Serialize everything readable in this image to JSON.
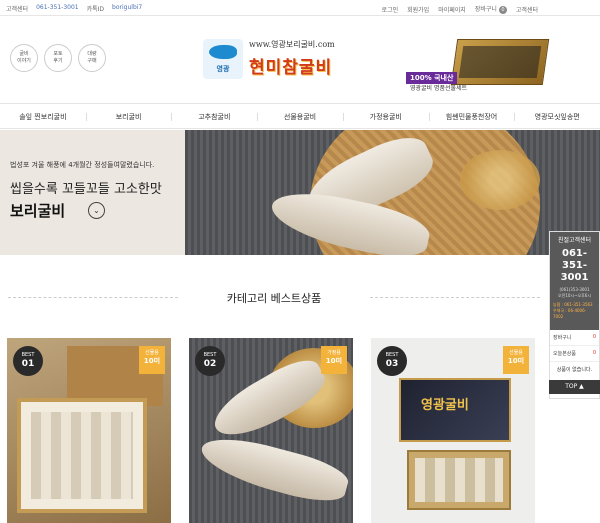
{
  "topbar": {
    "cs_label": "고객센터",
    "cs_phone": "061-351-3001",
    "kakao_label": "카톡ID",
    "kakao_id": "borigulbi7",
    "links": [
      "로그인",
      "회원가입",
      "마이페이지",
      "장바구니",
      "고객센터"
    ],
    "cart_count": "0"
  },
  "quick_links": [
    "굴비\n이야기",
    "포토\n후기",
    "대량\n구매"
  ],
  "logo": {
    "url": "www.영광보리굴비.com",
    "badge_name": "영광",
    "name": "현미참굴비"
  },
  "promo": {
    "tag": "100% 국내산",
    "sub": "영광굴비 명품선물세트"
  },
  "nav": [
    "솔잎 찐보리굴비",
    "보리굴비",
    "고추참굴비",
    "선물용굴비",
    "가정용굴비",
    "힘쎈민물풍천장어",
    "영광모싯잎송편"
  ],
  "hero": {
    "sub": "법성포 겨울 해풍에 4개월간 정성들여말렸습니다.",
    "line1": "씹을수록 꼬들꼬들 고소한맛",
    "line2": "보리굴비",
    "more": "⌄"
  },
  "section_title": "카테고리 베스트상품",
  "products": [
    {
      "best": "BEST",
      "rank": "01",
      "ribbon_top": "선물용",
      "ribbon_bottom": "10미"
    },
    {
      "best": "BEST",
      "rank": "02",
      "ribbon_top": "가정용",
      "ribbon_bottom": "10미"
    },
    {
      "best": "BEST",
      "rank": "03",
      "ribbon_top": "선물용",
      "ribbon_bottom": "10미",
      "box_text": "영광굴비"
    }
  ],
  "sidebar": {
    "title": "친절고객센터",
    "tel": "061-351-3001",
    "hours_line1": "(061)353-3001",
    "hours_line2": "오전10시~오후6시",
    "bank_line1": "농협 : 061-351-3563",
    "bank_line2": "우체국 : 06-4006-7002",
    "cart_label": "장바구니",
    "cart_count": "0",
    "today_label": "오늘본상품",
    "today_count": "0",
    "empty": "상품이 없습니다.",
    "top_button": "TOP ▲"
  }
}
